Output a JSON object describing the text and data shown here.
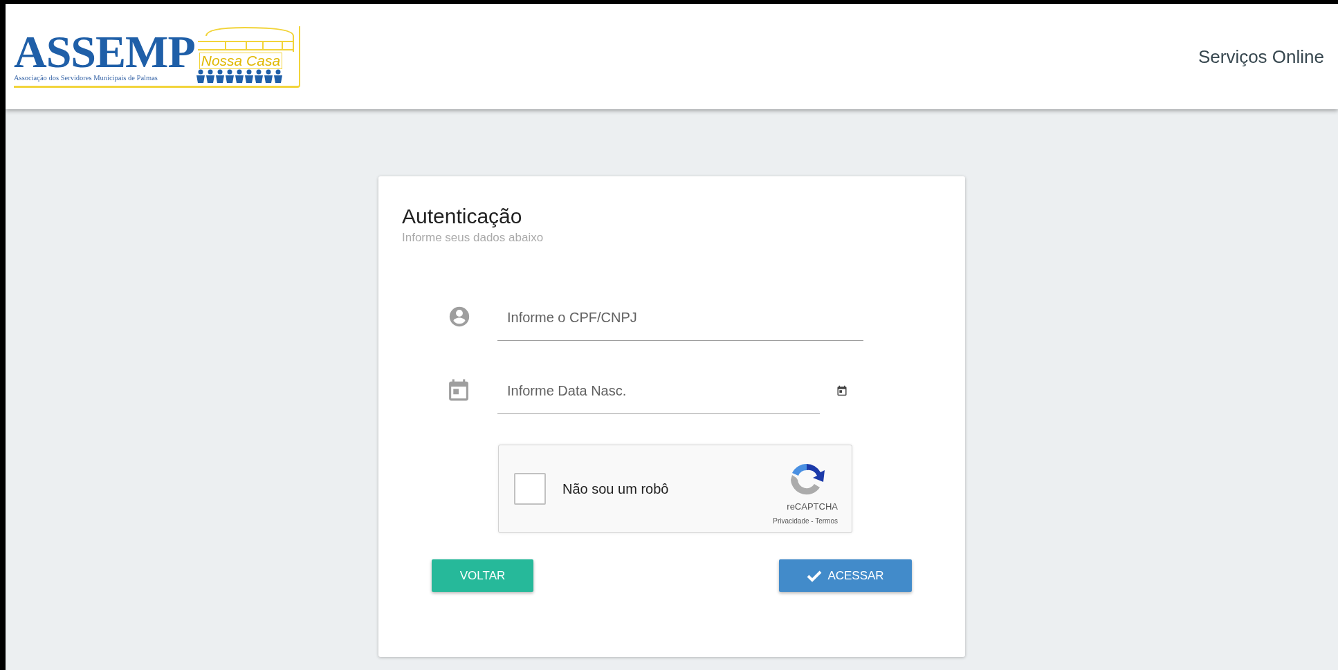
{
  "header": {
    "logo": {
      "name": "ASSEMP",
      "tagline": "Nossa Casa",
      "subtitle": "Associação dos Servidores Municipais de Palmas"
    },
    "title": "Serviços Online"
  },
  "card": {
    "title": "Autenticação",
    "subtitle": "Informe seus dados abaixo"
  },
  "fields": [
    {
      "kind": "text",
      "placeholder": "Informe o CPF/CNPJ"
    },
    {
      "kind": "date",
      "placeholder": "Informe Data Nasc."
    }
  ],
  "captcha": {
    "label": "Não sou um robô",
    "checked": false,
    "brand": "reCAPTCHA",
    "links": "Privacidade - Termos"
  },
  "buttons": [
    {
      "kind": "back",
      "label": "VOLTAR"
    },
    {
      "kind": "submit",
      "label": "ACESSAR"
    }
  ]
}
